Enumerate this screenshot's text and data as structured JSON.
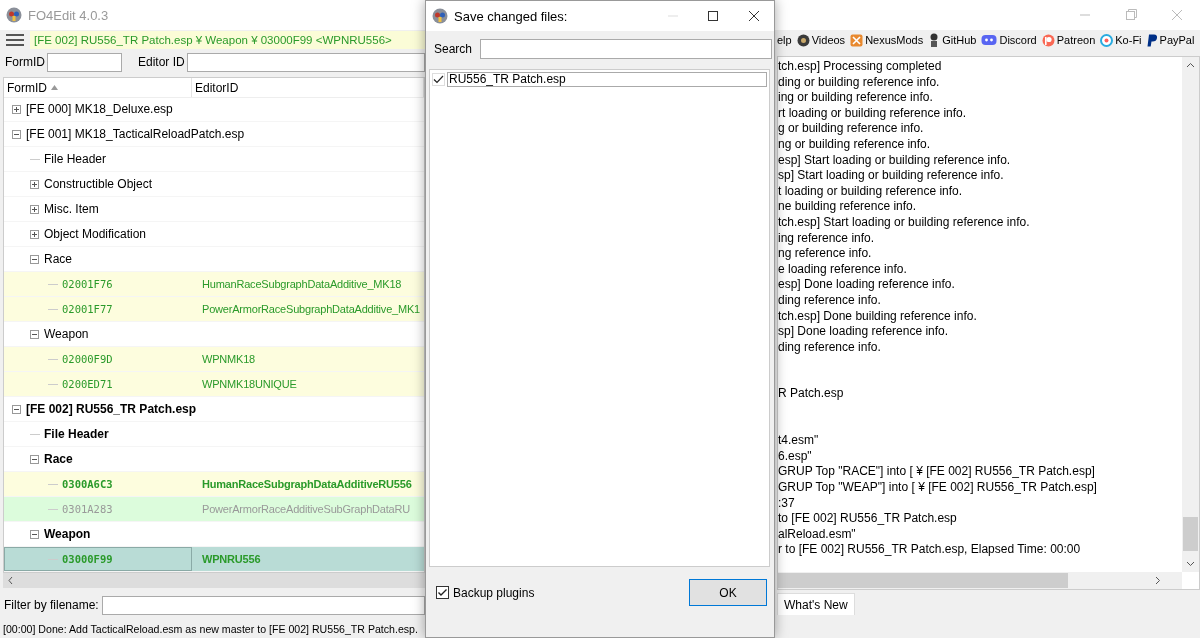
{
  "window": {
    "title": "FO4Edit 4.0.3"
  },
  "toolbar": {
    "path": "[FE 002] RU556_TR Patch.esp ¥ Weapon ¥ 03000F99 <WPNRU556>",
    "links": [
      {
        "label": "elp",
        "kind": "text"
      },
      {
        "label": "Videos",
        "kind": "video"
      },
      {
        "label": "NexusMods",
        "kind": "nexus"
      },
      {
        "label": "GitHub",
        "kind": "github"
      },
      {
        "label": "Discord",
        "kind": "discord"
      },
      {
        "label": "Patreon",
        "kind": "patreon"
      },
      {
        "label": "Ko-Fi",
        "kind": "kofi"
      },
      {
        "label": "PayPal",
        "kind": "paypal"
      }
    ]
  },
  "search": {
    "formid_label": "FormID",
    "editorid_label": "Editor ID"
  },
  "tree": {
    "columns": [
      {
        "label": "FormID",
        "sorted": true
      },
      {
        "label": "EditorID",
        "sorted": false
      }
    ],
    "items": [
      {
        "kind": "file",
        "label": "[FE 000] MK18_Deluxe.esp",
        "expanded": false,
        "modified": false,
        "selected": false
      },
      {
        "kind": "file",
        "label": "[FE 001] MK18_TacticalReloadPatch.esp",
        "expanded": true,
        "modified": false,
        "selected": false,
        "children": [
          {
            "kind": "header",
            "label": "File Header",
            "modified": false,
            "selected": false
          },
          {
            "kind": "group",
            "label": "Constructible Object",
            "expanded": false,
            "modified": false,
            "selected": false
          },
          {
            "kind": "group",
            "label": "Misc. Item",
            "expanded": false,
            "modified": false,
            "selected": false
          },
          {
            "kind": "group",
            "label": "Object Modification",
            "expanded": false,
            "modified": false,
            "selected": false
          },
          {
            "kind": "group",
            "label": "Race",
            "expanded": true,
            "modified": false,
            "selected": false,
            "children": [
              {
                "kind": "record",
                "form_id": "02001F76",
                "editor_id": "HumanRaceSubgraphDataAdditive_MK18",
                "identical": false,
                "modified": false,
                "selected": false
              },
              {
                "kind": "record",
                "form_id": "02001F77",
                "editor_id": "PowerArmorRaceSubgraphDataAdditive_MK1",
                "identical": false,
                "modified": false,
                "selected": false
              }
            ]
          },
          {
            "kind": "group",
            "label": "Weapon",
            "expanded": true,
            "modified": false,
            "selected": false,
            "children": [
              {
                "kind": "record",
                "form_id": "02000F9D",
                "editor_id": "WPNMK18",
                "identical": false,
                "modified": false,
                "selected": false
              },
              {
                "kind": "record",
                "form_id": "0200ED71",
                "editor_id": "WPNMK18UNIQUE",
                "identical": false,
                "modified": false,
                "selected": false
              }
            ]
          }
        ]
      },
      {
        "kind": "file",
        "label": "[FE 002] RU556_TR Patch.esp",
        "expanded": true,
        "modified": true,
        "selected": false,
        "children": [
          {
            "kind": "header",
            "label": "File Header",
            "modified": true,
            "selected": false
          },
          {
            "kind": "group",
            "label": "Race",
            "expanded": true,
            "modified": true,
            "selected": false,
            "children": [
              {
                "kind": "record",
                "form_id": "0300A6C3",
                "editor_id": "HumanRaceSubgraphDataAdditiveRU556",
                "identical": false,
                "modified": true,
                "selected": false
              },
              {
                "kind": "record",
                "form_id": "0301A283",
                "editor_id": "PowerArmorRaceAdditiveSubGraphDataRU",
                "identical": true,
                "modified": false,
                "selected": false
              }
            ]
          },
          {
            "kind": "group",
            "label": "Weapon",
            "expanded": true,
            "modified": true,
            "selected": false,
            "children": [
              {
                "kind": "record",
                "form_id": "03000F99",
                "editor_id": "WPNRU556",
                "identical": false,
                "modified": true,
                "selected": true
              }
            ]
          }
        ]
      }
    ]
  },
  "filter": {
    "label": "Filter by filename:"
  },
  "status_bar": "[00:00] Done: Add TacticalReload.esm as new master to [FE 002] RU556_TR Patch.esp.",
  "log": {
    "blocks": [
      [
        "tch.esp] Processing completed",
        "ding or building reference info.",
        "ing or building reference info.",
        "rt loading or building reference info.",
        "g or building reference info.",
        "ng or building reference info.",
        "esp] Start loading or building reference info.",
        "sp] Start loading or building reference info.",
        "t loading or building reference info.",
        "ne building reference info.",
        "tch.esp] Start loading or building reference info.",
        "ing reference info.",
        "ng reference info.",
        "e loading reference info.",
        "esp] Done loading reference info.",
        "ding reference info.",
        "tch.esp] Done building reference info.",
        "sp] Done loading reference info.",
        "ding reference info."
      ],
      [
        "R Patch.esp"
      ],
      [
        "t4.esm\"",
        "6.esp\"",
        "GRUP Top \"RACE\"] into [ ¥ [FE 002] RU556_TR Patch.esp]",
        "GRUP Top \"WEAP\"] into [ ¥ [FE 002] RU556_TR Patch.esp]",
        ":37",
        "to [FE 002] RU556_TR Patch.esp",
        "alReload.esm\"",
        "r to [FE 002] RU556_TR Patch.esp, Elapsed Time: 00:00"
      ]
    ]
  },
  "tabs": [
    {
      "label": "What's New",
      "selected": true
    }
  ],
  "dialog": {
    "title": "Save changed files:",
    "search_label": "Search",
    "files": [
      {
        "name": "RU556_TR Patch.esp",
        "checked": true,
        "selected": true
      }
    ],
    "backup": {
      "label": "Backup plugins",
      "checked": true
    },
    "ok": "OK"
  }
}
